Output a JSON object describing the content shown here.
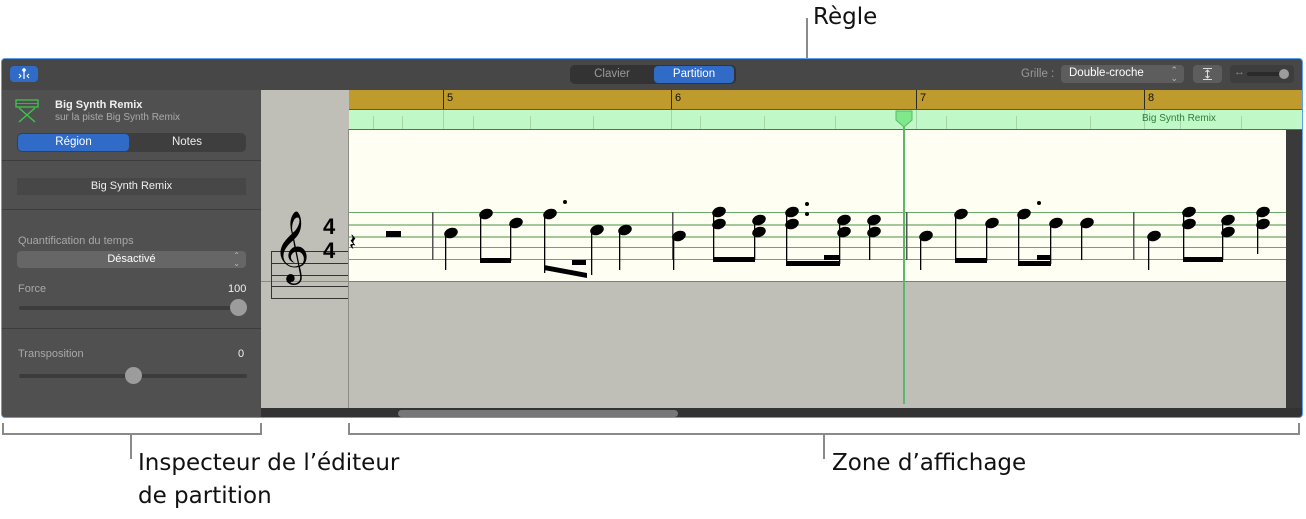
{
  "callouts": {
    "ruler": "Règle",
    "inspector_line1": "Inspecteur de l’éditeur",
    "inspector_line2": "de partition",
    "display_area": "Zone d’affichage"
  },
  "toolbar": {
    "view_tabs": [
      {
        "label": "Clavier",
        "active": false
      },
      {
        "label": "Partition",
        "active": true
      }
    ],
    "grid_label": "Grille :",
    "grid_value": "Double-croche",
    "zoom_level": 0.5
  },
  "inspector": {
    "track_name": "Big Synth Remix",
    "track_subtitle": "sur la piste Big Synth Remix",
    "tabs": [
      {
        "label": "Région",
        "active": true
      },
      {
        "label": "Notes",
        "active": false
      }
    ],
    "region_name": "Big Synth Remix",
    "quantize_label": "Quantification du temps",
    "quantize_value": "Désactivé",
    "strength_label": "Force",
    "strength_value": "100",
    "strength_fraction": 1.0,
    "transpose_label": "Transposition",
    "transpose_value": "0",
    "transpose_fraction": 0.5
  },
  "editor": {
    "ruler_bars": [
      "5",
      "6",
      "7",
      "8"
    ],
    "region_label": "Big Synth Remix",
    "time_signature": {
      "top": "4",
      "bottom": "4"
    },
    "colors": {
      "ruler": "#bf9a2c",
      "region": "#c0f8c8",
      "playhead": "#5bb865",
      "accent": "#2f6bc7"
    }
  }
}
